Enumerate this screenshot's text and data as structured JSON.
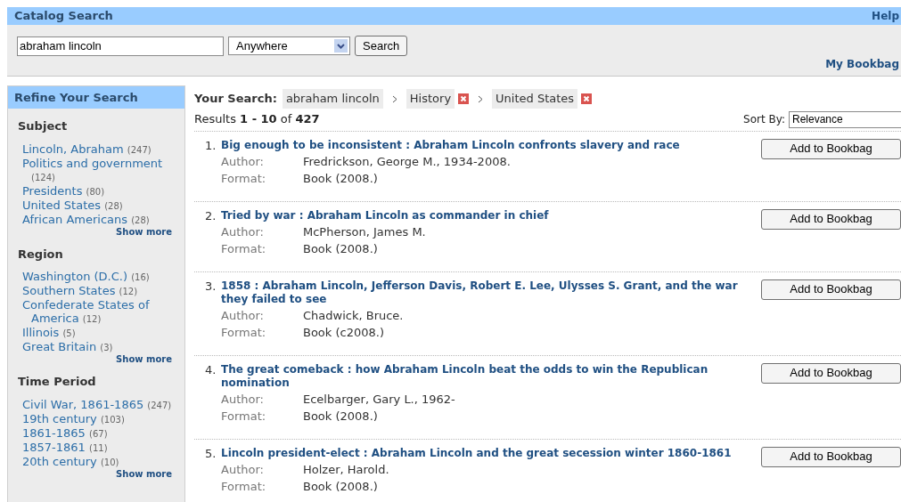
{
  "header": {
    "title": "Catalog Search",
    "help_link": "Help"
  },
  "search": {
    "query": "abraham lincoln",
    "scope": "Anywhere",
    "button": "Search",
    "bookbag_link": "My Bookbag"
  },
  "sidebar": {
    "title": "Refine Your Search",
    "facets": [
      {
        "heading": "Subject",
        "items": [
          {
            "label": "Lincoln, Abraham",
            "count": "(247)"
          },
          {
            "label": "Politics and government",
            "count": "(124)"
          },
          {
            "label": "Presidents",
            "count": "(80)"
          },
          {
            "label": "United States",
            "count": "(28)"
          },
          {
            "label": "African Americans",
            "count": "(28)"
          }
        ],
        "show_more": "Show more"
      },
      {
        "heading": "Region",
        "items": [
          {
            "label": "Washington (D.C.)",
            "count": "(16)"
          },
          {
            "label": "Southern States",
            "count": "(12)"
          },
          {
            "label": "Confederate States of America",
            "count": "(12)"
          },
          {
            "label": "Illinois",
            "count": "(5)"
          },
          {
            "label": "Great Britain",
            "count": "(3)"
          }
        ],
        "show_more": "Show more"
      },
      {
        "heading": "Time Period",
        "items": [
          {
            "label": "Civil War, 1861-1865",
            "count": "(247)"
          },
          {
            "label": "19th century",
            "count": "(103)"
          },
          {
            "label": "1861-1865",
            "count": "(67)"
          },
          {
            "label": "1857-1861",
            "count": "(11)"
          },
          {
            "label": "20th century",
            "count": "(10)"
          }
        ],
        "show_more": "Show more"
      }
    ]
  },
  "main": {
    "your_search_label": "Your Search:",
    "breadcrumbs": [
      {
        "label": "abraham lincoln",
        "removable": false
      },
      {
        "label": "History",
        "removable": true
      },
      {
        "label": "United States",
        "removable": true
      }
    ],
    "results_summary": "Results **1 - 10** of **427**",
    "sort_label": "Sort By:",
    "sort_value": "Relevance",
    "results": [
      {
        "number": "1.",
        "title": "Big enough to be inconsistent : Abraham Lincoln confronts slavery and race",
        "fields": [
          {
            "label": "Author:",
            "value": "Fredrickson, George M., 1934-2008."
          },
          {
            "label": "Format:",
            "value": "Book (2008.)"
          }
        ],
        "button": "Add to Bookbag"
      },
      {
        "number": "2.",
        "title": "Tried by war : Abraham Lincoln as commander in chief",
        "fields": [
          {
            "label": "Author:",
            "value": "McPherson, James M."
          },
          {
            "label": "Format:",
            "value": "Book (2008.)"
          }
        ],
        "button": "Add to Bookbag"
      },
      {
        "number": "3.",
        "title": "1858 : Abraham Lincoln, Jefferson Davis, Robert E. Lee, Ulysses S. Grant, and the war they failed to see",
        "fields": [
          {
            "label": "Author:",
            "value": "Chadwick, Bruce."
          },
          {
            "label": "Format:",
            "value": "Book (c2008.)"
          }
        ],
        "button": "Add to Bookbag"
      },
      {
        "number": "4.",
        "title": "The great comeback : how Abraham Lincoln beat the odds to win the Republican nomination",
        "fields": [
          {
            "label": "Author:",
            "value": "Ecelbarger, Gary L., 1962-"
          },
          {
            "label": "Format:",
            "value": "Book (2008.)"
          }
        ],
        "button": "Add to Bookbag"
      },
      {
        "number": "5.",
        "title": "Lincoln president-elect : Abraham Lincoln and the great secession winter 1860-1861",
        "fields": [
          {
            "label": "Author:",
            "value": "Holzer, Harold."
          },
          {
            "label": "Format:",
            "value": "Book (2008.)"
          }
        ],
        "button": "Add to Bookbag"
      }
    ]
  }
}
